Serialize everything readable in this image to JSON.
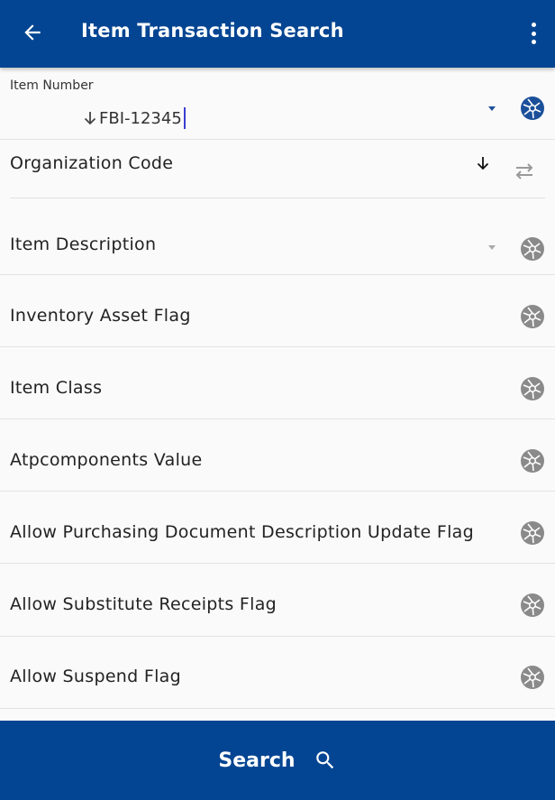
{
  "header": {
    "title": "Item Transaction Search"
  },
  "item_number": {
    "label": "Item Number",
    "value": "FBI-12345"
  },
  "organization_code": {
    "label": "Organization Code"
  },
  "fields": [
    {
      "label": "Item Description"
    },
    {
      "label": "Inventory Asset Flag"
    },
    {
      "label": "Item Class"
    },
    {
      "label": "Atpcomponents Value"
    },
    {
      "label": "Allow Purchasing Document Description Update Flag"
    },
    {
      "label": "Allow Substitute Receipts Flag"
    },
    {
      "label": "Allow Suspend Flag"
    }
  ],
  "search_button": {
    "label": "Search"
  },
  "colors": {
    "primary": "#034592",
    "active_icon": "#1b4f9a",
    "inactive_icon": "#8a8a8a"
  },
  "icons": {
    "back": "arrow-left-icon",
    "menu": "more-vert-icon",
    "scan": "camera-shutter-icon",
    "swap": "swap-icon",
    "search": "search-icon"
  }
}
